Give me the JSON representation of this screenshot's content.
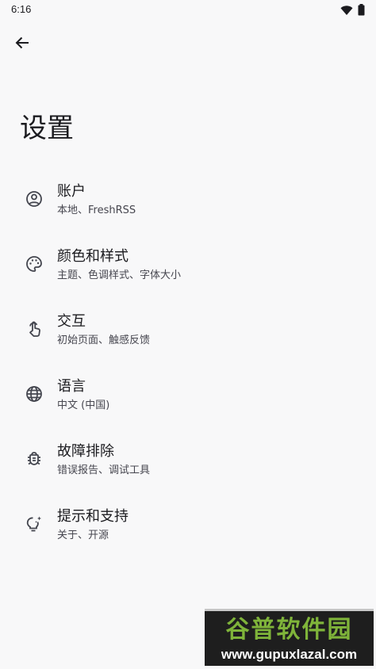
{
  "status_bar": {
    "time": "6:16",
    "icons": [
      "wifi-icon",
      "battery-icon"
    ]
  },
  "header": {
    "back_icon": "arrow-back-icon",
    "title": "设置"
  },
  "settings": [
    {
      "icon": "account-circle-icon",
      "title": "账户",
      "subtitle": "本地、FreshRSS"
    },
    {
      "icon": "palette-icon",
      "title": "颜色和样式",
      "subtitle": "主题、色调样式、字体大小"
    },
    {
      "icon": "touch-icon",
      "title": "交互",
      "subtitle": "初始页面、触感反馈"
    },
    {
      "icon": "globe-icon",
      "title": "语言",
      "subtitle": "中文 (中国)"
    },
    {
      "icon": "bug-icon",
      "title": "故障排除",
      "subtitle": "错误报告、调试工具"
    },
    {
      "icon": "lightbulb-icon",
      "title": "提示和支持",
      "subtitle": "关于、开源"
    }
  ],
  "watermark": {
    "title": "谷普软件园",
    "url": "www.gupuxlazal.com"
  },
  "colors": {
    "background": "#f8f8f9",
    "text": "#1b1b1f",
    "icon": "#44464f",
    "watermark_green": "#7fb43a"
  }
}
